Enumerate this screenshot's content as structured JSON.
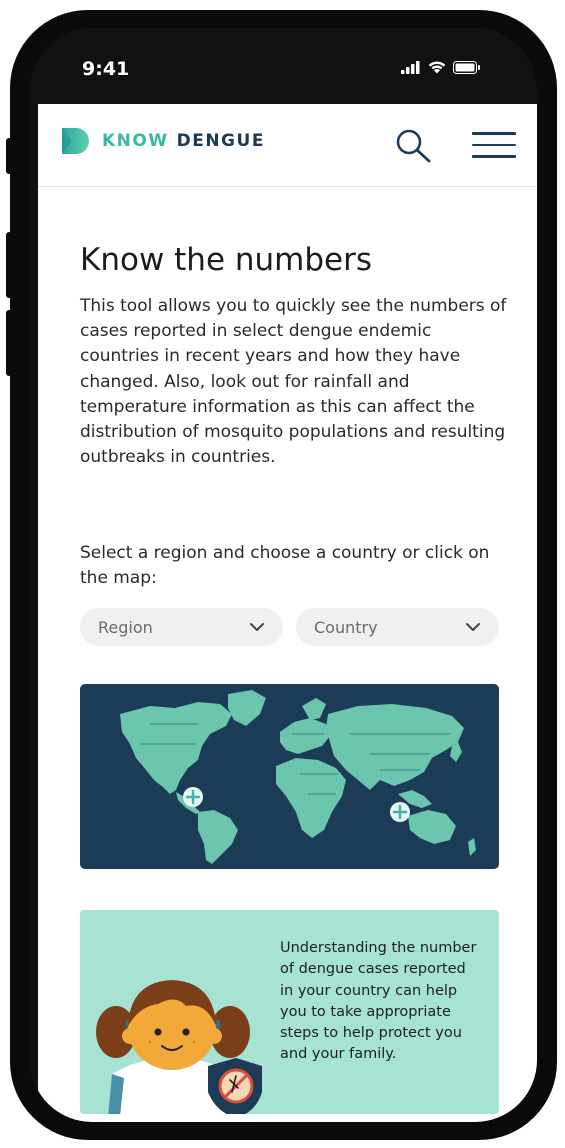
{
  "status_bar": {
    "time": "9:41"
  },
  "header": {
    "logo_know": "KNOW",
    "logo_dengue": "DENGUE",
    "search_icon": "search-icon",
    "menu_icon": "hamburger-menu-icon"
  },
  "main": {
    "title": "Know the numbers",
    "intro": "This tool allows you to quickly see the numbers of cases reported in select dengue endemic countries in recent years and how they have changed. Also, look out for rainfall and temperature information as this can affect the distribution of mosquito populations and resulting outbreaks in countries.",
    "select_prompt": "Select a region and choose a country or click on the map:",
    "region_dropdown": {
      "selected": "Region"
    },
    "country_dropdown": {
      "selected": "Country"
    },
    "info_card": {
      "text": "Understanding the number of dengue cases reported in your country can help you to take appropriate steps to help protect you and your family."
    }
  },
  "colors": {
    "brand_teal": "#3bb8a3",
    "brand_navy": "#1a3a57",
    "map_ocean": "#1b3b56",
    "map_land": "#6cc6ad",
    "info_card_bg": "#a6e3d3"
  }
}
